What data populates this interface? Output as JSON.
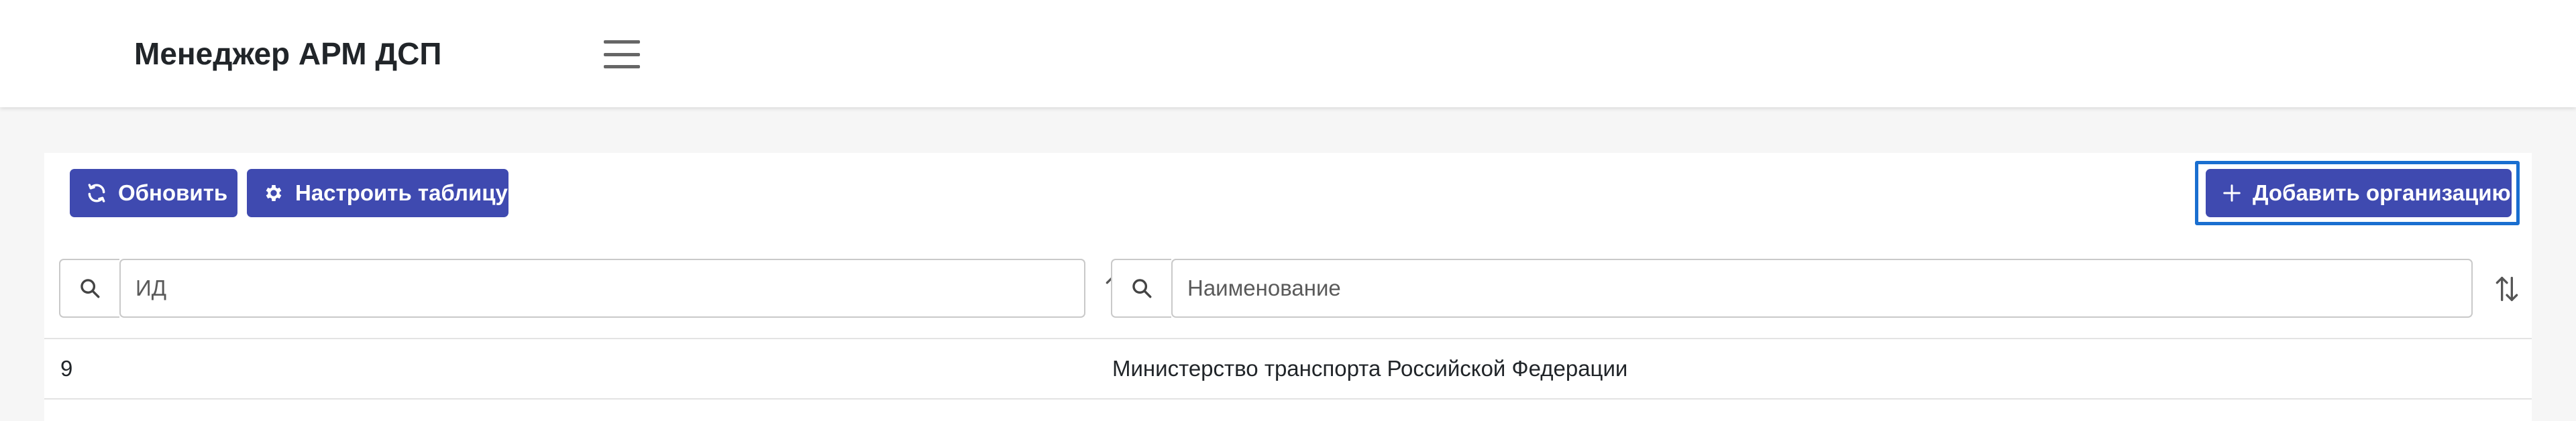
{
  "header": {
    "app_title": "Менеджер АРМ ДСП",
    "menu_icon": "hamburger-icon"
  },
  "toolbar": {
    "refresh_label": "Обновить",
    "refresh_icon": "refresh-icon",
    "configure_label": "Настроить таблицу",
    "configure_icon": "gear-icon",
    "add_label": "Добавить организацию",
    "add_icon": "plus-icon"
  },
  "filters": {
    "id": {
      "value": "",
      "placeholder": "ИД",
      "icon": "search-icon",
      "sort_icon": "sort-icon"
    },
    "name": {
      "value": "",
      "placeholder": "Наименование",
      "icon": "search-icon",
      "sort_icon": "sort-icon"
    }
  },
  "table": {
    "rows": [
      {
        "id": "9",
        "name": "Министерство транспорта Российской Федерации"
      }
    ]
  },
  "colors": {
    "primary_button": "#3f4ab0",
    "focus_ring": "#1a6fd0",
    "header_bg": "#ffffff",
    "page_bg": "#f6f6f6"
  }
}
